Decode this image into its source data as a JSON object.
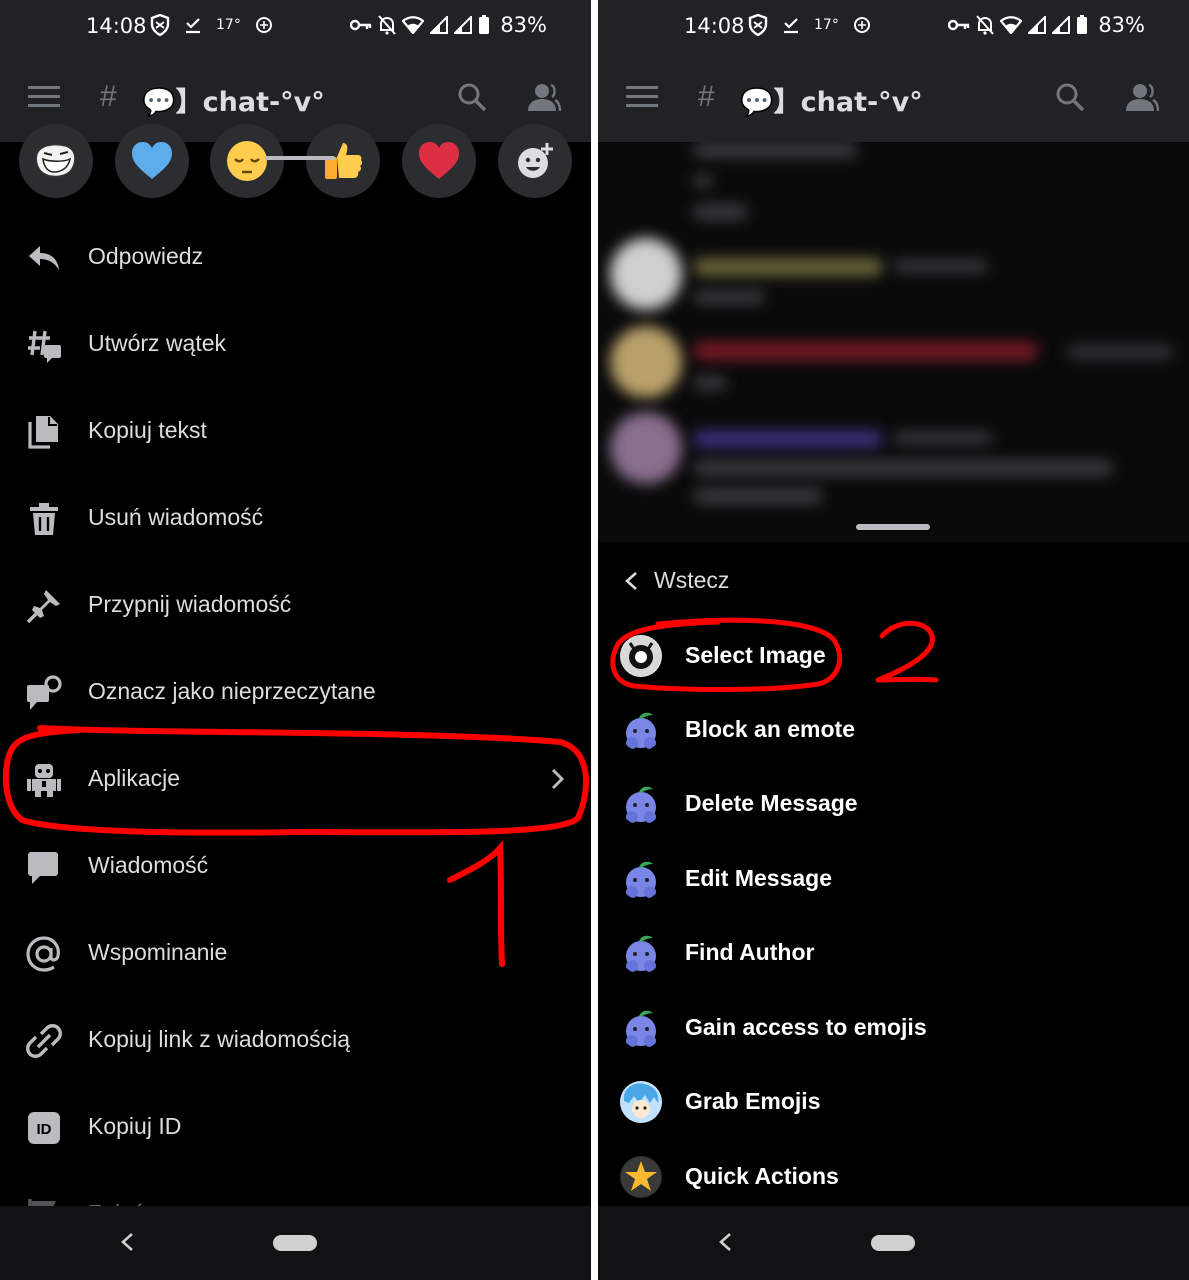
{
  "status_bar": {
    "time": "14:08",
    "temperature": "17°",
    "battery": "83%"
  },
  "header": {
    "channel_hash": "#",
    "channel_name": "💬】chat-°v°"
  },
  "reactions": [
    "troll-face",
    "blue-heart",
    "pensive-face",
    "thumbs-up",
    "red-heart",
    "add-reaction"
  ],
  "left_menu": {
    "items": [
      {
        "label": "Odpowiedz",
        "icon": "reply-icon"
      },
      {
        "label": "Utwórz wątek",
        "icon": "thread-icon"
      },
      {
        "label": "Kopiuj tekst",
        "icon": "copy-icon"
      },
      {
        "label": "Usuń wiadomość",
        "icon": "trash-icon"
      },
      {
        "label": "Przypnij wiadomość",
        "icon": "pin-icon"
      },
      {
        "label": "Oznacz jako nieprzeczytane",
        "icon": "mark-unread-icon"
      },
      {
        "label": "Aplikacje",
        "icon": "apps-robot-icon"
      },
      {
        "label": "Wiadomość",
        "icon": "message-icon"
      },
      {
        "label": "Wspominanie",
        "icon": "at-icon"
      },
      {
        "label": "Kopiuj link z wiadomością",
        "icon": "link-icon"
      },
      {
        "label": "Kopiuj ID",
        "icon": "id-icon"
      },
      {
        "label": "Zgłoś",
        "icon": "flag-icon"
      }
    ]
  },
  "right_menu": {
    "back_label": "Wstecz",
    "apps": [
      {
        "label": "Select Image",
        "icon": "select-image-bot-icon"
      },
      {
        "label": "Block an emote",
        "icon": "blue-bot-icon"
      },
      {
        "label": "Delete Message",
        "icon": "blue-bot-icon"
      },
      {
        "label": "Edit Message",
        "icon": "blue-bot-icon"
      },
      {
        "label": "Find Author",
        "icon": "blue-bot-icon"
      },
      {
        "label": "Gain access to emojis",
        "icon": "blue-bot-icon"
      },
      {
        "label": "Grab Emojis",
        "icon": "grab-emojis-bot-icon"
      },
      {
        "label": "Quick Actions",
        "icon": "star-bot-icon"
      }
    ]
  },
  "annotations": {
    "step1": "1",
    "step2": "2",
    "color": "#ff0000"
  }
}
